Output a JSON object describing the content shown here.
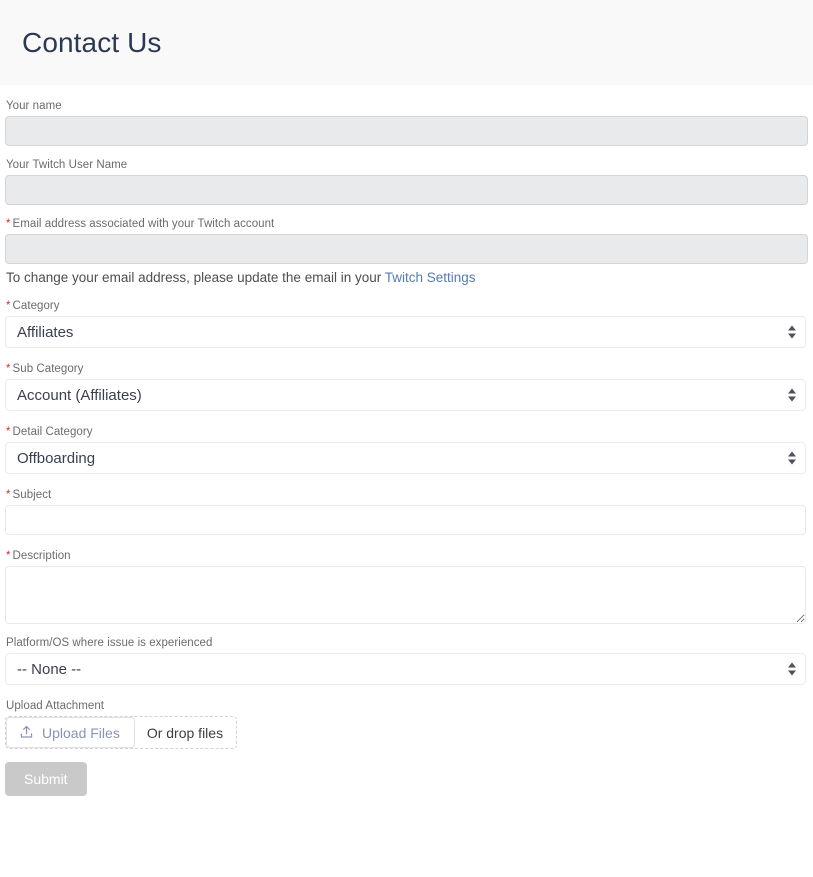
{
  "header": {
    "title": "Contact Us"
  },
  "form": {
    "fields": {
      "your_name": {
        "label": "Your name",
        "value": "",
        "placeholder": "",
        "required": false,
        "disabled": true
      },
      "twitch_user_name": {
        "label": "Your Twitch User Name",
        "value": "",
        "placeholder": "",
        "required": false,
        "disabled": true
      },
      "email": {
        "label": "Email address associated with your Twitch account",
        "required_marker": "*",
        "value": "",
        "placeholder": "",
        "required": true,
        "disabled": true,
        "helper_prefix": "To change your email address, please update the email in your ",
        "helper_link": "Twitch Settings"
      },
      "category": {
        "label": "Category",
        "required_marker": "*",
        "value": "Affiliates",
        "required": true
      },
      "sub_category": {
        "label": "Sub Category",
        "required_marker": "*",
        "value": "Account (Affiliates)",
        "required": true
      },
      "detail_category": {
        "label": "Detail Category",
        "required_marker": "*",
        "value": "Offboarding",
        "required": true
      },
      "subject": {
        "label": "Subject",
        "required_marker": "*",
        "value": "",
        "placeholder": "",
        "required": true
      },
      "description": {
        "label": "Description",
        "required_marker": "*",
        "value": "",
        "placeholder": "",
        "required": true
      },
      "platform_os": {
        "label": "Platform/OS where issue is experienced",
        "value": "-- None --",
        "required": false
      },
      "upload_attachment": {
        "label": "Upload Attachment",
        "button_label": "Upload Files",
        "button_icon": "upload-icon",
        "drop_text": "Or drop files"
      }
    },
    "submit_label": "Submit"
  },
  "colors": {
    "header_band": "#f9f9f9",
    "title": "#2b3a53",
    "label": "#6b6b70",
    "required_asterisk": "#c23934",
    "disabled_input_bg": "#e9eaec",
    "disabled_input_border": "#d3d4d7",
    "input_border": "#e8e8ea",
    "link": "#557bb5",
    "upload_button_text": "#8b93b6",
    "submit_bg": "#c9c9ca",
    "submit_text": "#ffffff"
  }
}
